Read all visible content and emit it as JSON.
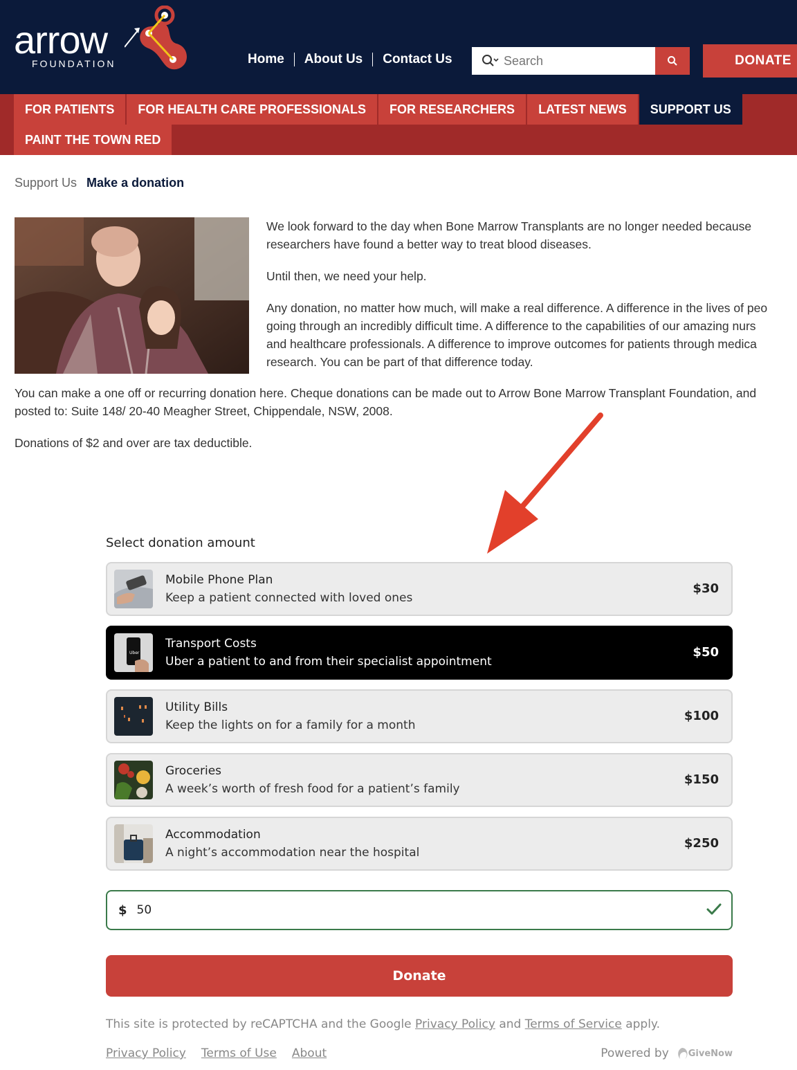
{
  "header": {
    "logo_word": "arrow",
    "logo_sub": "FOUNDATION",
    "nav": [
      "Home",
      "About Us",
      "Contact Us"
    ],
    "search_placeholder": "Search",
    "donate_label": "DONATE"
  },
  "mainnav": {
    "row1": [
      {
        "label": "FOR PATIENTS",
        "active": false
      },
      {
        "label": "FOR HEALTH CARE PROFESSIONALS",
        "active": false
      },
      {
        "label": "FOR RESEARCHERS",
        "active": false
      },
      {
        "label": "LATEST NEWS",
        "active": false
      },
      {
        "label": "SUPPORT US",
        "active": true
      }
    ],
    "row2": [
      {
        "label": "PAINT THE TOWN RED",
        "active": false
      }
    ]
  },
  "breadcrumb": {
    "parent": "Support Us",
    "current": "Make a donation"
  },
  "content": {
    "hero_paragraphs": [
      "We look forward to the day when Bone Marrow Transplants are no longer needed because",
      "researchers have found a better way to treat blood diseases.",
      "Until then, we need your help.",
      "Any donation, no matter how much, will make a real difference. A difference in the lives of peo",
      "going through an incredibly difficult time. A difference to the capabilities of our amazing nurs",
      "and healthcare professionals. A difference to improve outcomes for patients through medica",
      "research. You can be part of that difference today."
    ],
    "lower_lines": [
      "You can make a one off or recurring donation here. Cheque donations can be made out to Arrow Bone Marrow Transplant Foundation, and",
      "posted to: Suite 148/ 20-40 Meagher Street, Chippendale, NSW, 2008.",
      "Donations of $2 and over are tax deductible."
    ]
  },
  "widget": {
    "title": "Select donation amount",
    "options": [
      {
        "title": "Mobile Phone Plan",
        "desc": "Keep a patient connected with loved ones",
        "price": "$30",
        "selected": false,
        "icon": "phone-photo"
      },
      {
        "title": "Transport Costs",
        "desc": "Uber a patient to and from their specialist appointment",
        "price": "$50",
        "selected": true,
        "icon": "uber-photo"
      },
      {
        "title": "Utility Bills",
        "desc": "Keep the lights on for a family for a month",
        "price": "$100",
        "selected": false,
        "icon": "night-building-photo"
      },
      {
        "title": "Groceries",
        "desc": "A week’s worth of fresh food for a patient’s family",
        "price": "$150",
        "selected": false,
        "icon": "vegetables-photo"
      },
      {
        "title": "Accommodation",
        "desc": "A night’s accommodation near the hospital",
        "price": "$250",
        "selected": false,
        "icon": "suitcase-photo"
      }
    ],
    "currency": "$",
    "amount": "50",
    "donate_label": "Donate",
    "recaptcha_pre": "This site is protected by reCAPTCHA and the Google",
    "recaptcha_privacy": "Privacy Policy",
    "recaptcha_and": "and",
    "recaptcha_terms": "Terms of Service",
    "recaptcha_post": "apply.",
    "footer_links": [
      "Privacy Policy",
      "Terms of Use",
      "About"
    ],
    "powered_by": "Powered by",
    "givenow": "GiveNow"
  },
  "colors": {
    "navy": "#0b1a3a",
    "red": "#c8413a",
    "dark_red": "#a02a29",
    "green": "#3a7a4a"
  }
}
